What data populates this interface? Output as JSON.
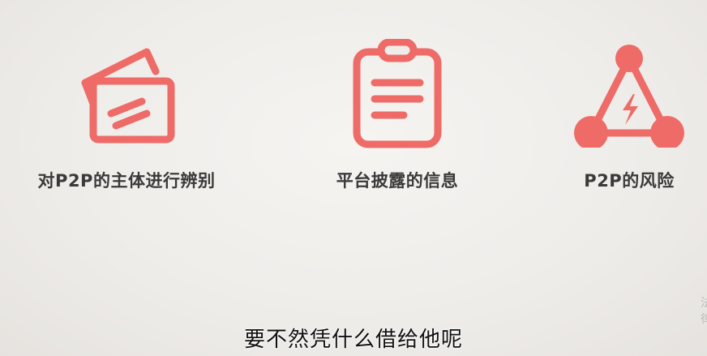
{
  "items": [
    {
      "label": "对P2P的主体进行辨别",
      "icon": "id-cards-icon"
    },
    {
      "label": "平台披露的信息",
      "icon": "clipboard-icon"
    },
    {
      "label": "P2P的风险",
      "icon": "risk-triangle-icon"
    }
  ],
  "subtitle": "要不然凭什么借给他呢",
  "edge_glyphs": [
    "法",
    "律"
  ],
  "colors": {
    "accent": "#ee6b67",
    "text": "#3a3a3a",
    "background": "#efedea"
  }
}
